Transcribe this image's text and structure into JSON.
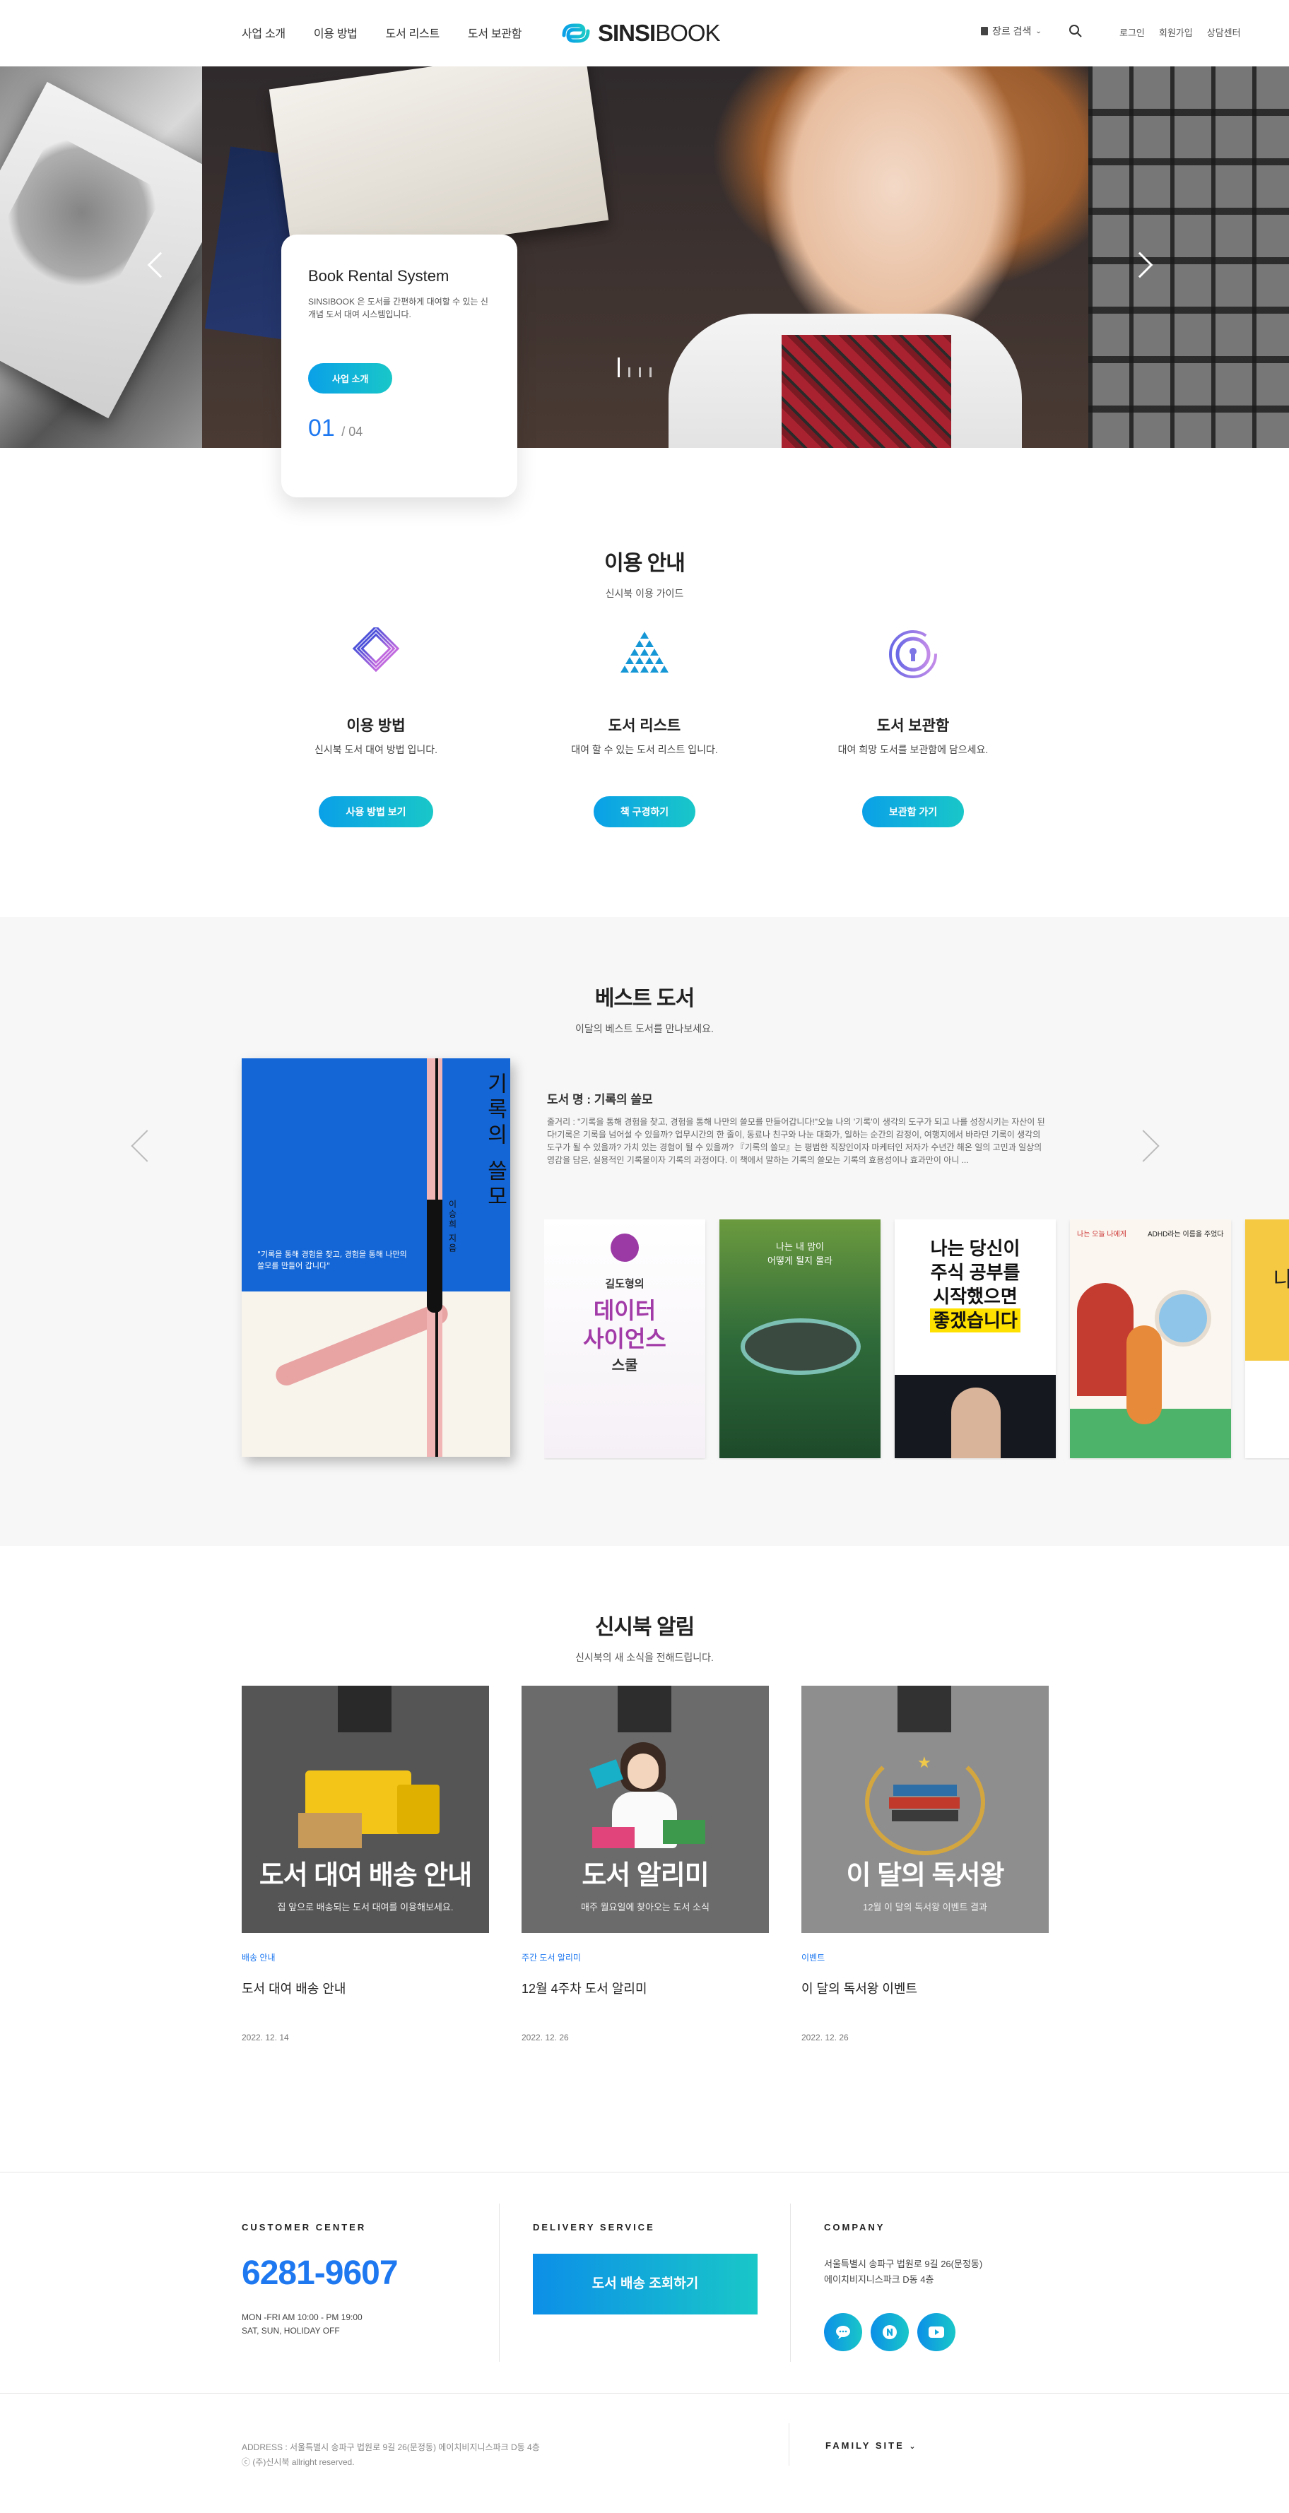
{
  "header": {
    "nav": [
      "사업 소개",
      "이용 방법",
      "도서 리스트",
      "도서 보관함"
    ],
    "logo_bold": "SINSI",
    "logo_light": "BOOK",
    "genre_search": "장르 검색",
    "member_links": [
      "로그인",
      "회원가입",
      "상담센터"
    ]
  },
  "hero": {
    "title": "Book Rental System",
    "desc": "SINSIBOOK 은 도서를 간편하게 대여할 수 있는 신개념 도서 대여 시스템입니다.",
    "button": "사업 소개",
    "current": "01",
    "total": "/ 04"
  },
  "guide": {
    "title": "이용 안내",
    "subtitle": "신시북 이용 가이드",
    "items": [
      {
        "icon": "diamond-layers-icon",
        "title": "이용 방법",
        "desc": "신시북 도서 대여 방법 입니다.",
        "button": "사용 방법 보기"
      },
      {
        "icon": "triangle-dots-icon",
        "title": "도서 리스트",
        "desc": "대여 할 수 있는 도서 리스트 입니다.",
        "button": "책 구경하기"
      },
      {
        "icon": "lock-circle-icon",
        "title": "도서 보관함",
        "desc": "대여 희망 도서를 보관함에 담으세요.",
        "button": "보관함 가기"
      }
    ]
  },
  "best": {
    "title": "베스트 도서",
    "subtitle": "이달의 베스트 도서를 만나보세요.",
    "book_title_text": "기록의 쓸모",
    "book_author": "이승희 지음",
    "book_quote": "\"기록을 통해 경험을 찾고, 경험을 통해 나만의 쓸모를 만들어 갑니다\"",
    "book_name": "도서 명 : 기록의 쓸모",
    "book_desc": "줄거리 : \"기록을 통해 경험을 찾고, 경험을 통해 나만의 쓸모를 만들어갑니다!\"오늘 나의 '기록'이 생각의 도구가 되고 나를 성장시키는 자산이 된다!기록은 기록을 넘어설 수 있을까? 업무시간의 한 줄이, 동료나 친구와 나눈 대화가, 일하는 순간의 감정이, 여행지에서 바라던 기록이 생각의 도구가 될 수 있을까? 가치 있는 경험이 될 수 있을까? 『기록의 쓸모』는 평범한 직장인이자 마케터인 저자가 수년간 해온 일의 고민과 일상의 영감을 담은, 실용적인 기록물이자 기록의 과정이다. 이 책에서 말하는 기록의 쓸모는 기록의 효용성이나 효과만이 아니 ...",
    "thumbs": [
      {
        "name": "data-science-book",
        "t1": "길도형의",
        "t2": "데이터",
        "t3": "사이언스",
        "t4": "스쿨"
      },
      {
        "name": "hammock-book",
        "t1": "나는 내 맘이",
        "t2": "어떻게 될지 몰라"
      },
      {
        "name": "stock-book",
        "t1": "나는 당신이",
        "t2": "주식 공부를",
        "t3": "시작했으면",
        "t4": "좋겠습니다"
      },
      {
        "name": "adhd-book",
        "t1": "나는 오늘 나에게",
        "t2": "ADHD라는 이름을 주었다"
      },
      {
        "name": "yellow-book",
        "t1": "나"
      }
    ]
  },
  "notice": {
    "title": "신시북 알림",
    "subtitle": "신시북의 새 소식을 전해드립니다.",
    "cards": [
      {
        "big": "도서 대여 배송 안내",
        "sub": "집 앞으로 배송되는 도서 대여를 이용해보세요.",
        "cat": "배송 안내",
        "title": "도서 대여 배송 안내",
        "date": "2022. 12. 14"
      },
      {
        "big": "도서 알리미",
        "sub": "매주 월요일에 찾아오는 도서 소식",
        "cat": "주간 도서 알리미",
        "title": "12월 4주차 도서 알리미",
        "date": "2022. 12. 26"
      },
      {
        "big": "이 달의 독서왕",
        "sub": "12월 이 달의 독서왕 이벤트 결과",
        "cat": "이벤트",
        "title": "이 달의 독서왕 이벤트",
        "date": "2022. 12. 26"
      }
    ]
  },
  "footer": {
    "cc_title": "CUSTOMER CENTER",
    "tel": "6281-9607",
    "hours1": "MON -FRI AM 10:00 - PM 19:00",
    "hours2": "SAT, SUN, HOLIDAY OFF",
    "ds_title": "DELIVERY SERVICE",
    "ds_button": "도서 배송 조회하기",
    "co_title": "COMPANY",
    "co_addr1": "서울특별시 송파구 법원로 9길 26(문정동)",
    "co_addr2": "에이치비지니스파크 D동 4층",
    "sns": [
      "talk-icon",
      "blog-icon",
      "youtube-icon"
    ],
    "address": "ADDRESS : 서울특별시 송파구 법원로 9길 26(문정동) 에이치비지니스파크 D동 4층",
    "copyright": "ⓒ (주)신시북 allright reserved.",
    "family": "FAMILY SITE"
  },
  "colors": {
    "accent": "#1e78f0",
    "gradient_start": "#0aa0e8",
    "gradient_end": "#19c7c8"
  }
}
